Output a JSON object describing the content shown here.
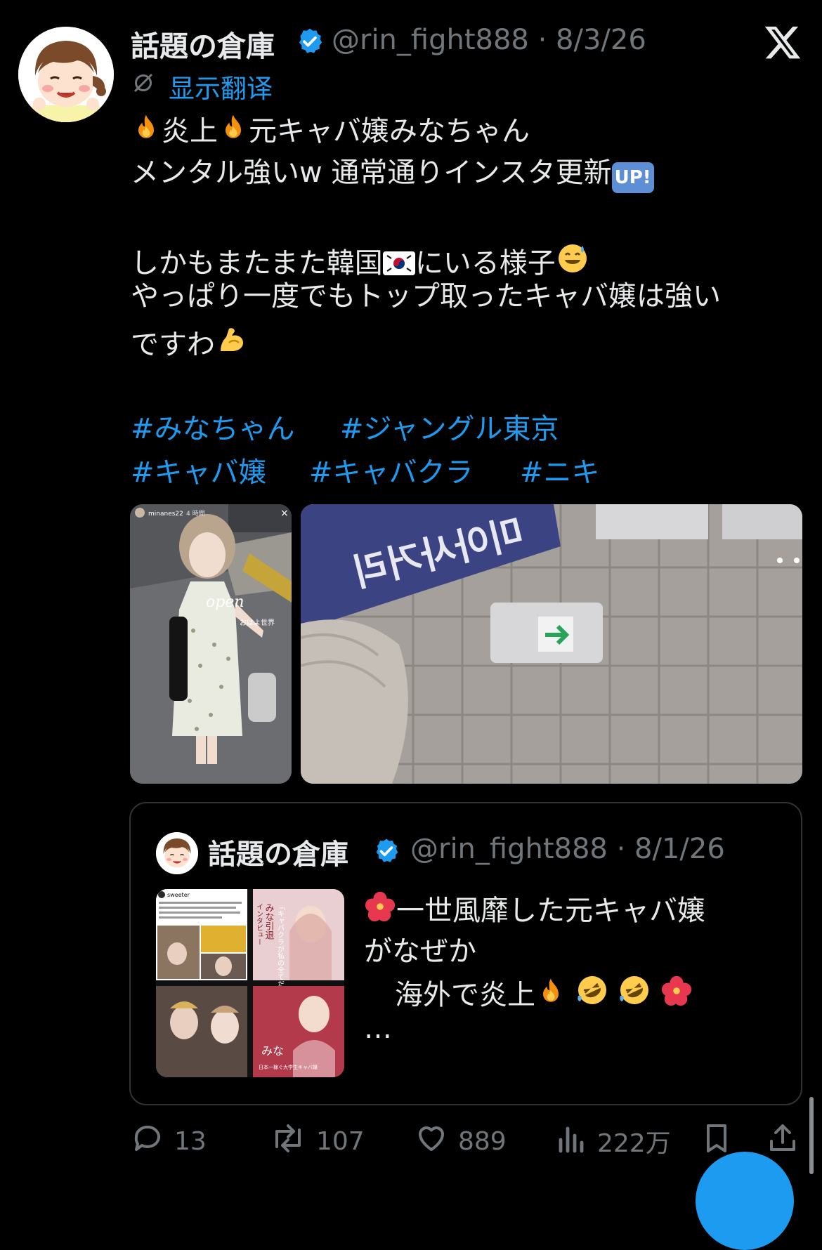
{
  "tweet": {
    "display_name": "話題の倉庫",
    "handle_date": "@rin_fight888 · 8/3/26",
    "translate_label": "显示翻译",
    "lines": [
      {
        "pre_emoji": "fire",
        "text": "炎上"
      },
      {
        "text": "元キャバ嬢みなちゃん"
      },
      {
        "text": "メンタル強いw 通常通りインスタ更新"
      },
      {
        "text": "しかもまたまた韓国"
      },
      {
        "text": "にいる様子"
      },
      {
        "text": "やっぱり一度でもトップ取ったキャバ嬢は強い"
      },
      {
        "text": "ですわ"
      }
    ],
    "up_badge": "UP!",
    "hashtags": [
      "#みなちゃん",
      "#ジャングル東京",
      "#キャバ嬢",
      "#キャバクラ",
      "#ニキ"
    ],
    "media": [
      {
        "story_user": "minanes22",
        "story_time": "4 時間",
        "caption_script": "open",
        "caption_jp": "おはよ世界"
      },
      {
        "sign_text": "미아사거리"
      }
    ]
  },
  "quoted": {
    "display_name": "話題の倉庫",
    "handle_date": "@rin_fight888 · 8/1/26",
    "line1": "一世風靡した元キャバ嬢",
    "line2": "がなぜか",
    "line3": "海外で炎上",
    "ellipsis": "…",
    "thumb_texts": {
      "tweet_user": "sweeter",
      "title_a": "みな引退",
      "title_b": "インタビュー",
      "title_c": "「キャバクラが私の全てだった」",
      "caption_mina": "みな",
      "caption_sub": "日本一稼ぐ大学生キャバ嬢"
    }
  },
  "actions": {
    "replies": "13",
    "reposts": "107",
    "likes": "889",
    "views": "222万"
  },
  "colors": {
    "background": "#000000",
    "text": "#e7e9ea",
    "muted": "#71767b",
    "accent": "#1d9bf0"
  },
  "icons": [
    "x-logo-icon",
    "verified-badge-icon",
    "translate-icon",
    "reply-icon",
    "repost-icon",
    "like-icon",
    "views-icon",
    "bookmark-icon",
    "share-icon"
  ]
}
